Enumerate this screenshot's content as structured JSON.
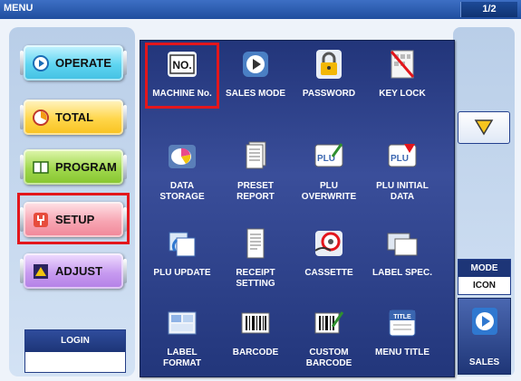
{
  "window": {
    "title": "MENU",
    "page_indicator": "1/2"
  },
  "sidebar": {
    "buttons": [
      {
        "label": "OPERATE",
        "icon": "operate-icon"
      },
      {
        "label": "TOTAL",
        "icon": "total-icon"
      },
      {
        "label": "PROGRAM",
        "icon": "program-icon"
      },
      {
        "label": "SETUP",
        "icon": "setup-icon"
      },
      {
        "label": "ADJUST",
        "icon": "adjust-icon"
      }
    ],
    "login_label": "LOGIN"
  },
  "menu_items": [
    {
      "label": "MACHINE No.",
      "icon": "machine-number-icon"
    },
    {
      "label": "SALES MODE",
      "icon": "sales-mode-icon"
    },
    {
      "label": "PASSWORD",
      "icon": "padlock-icon"
    },
    {
      "label": "KEY LOCK",
      "icon": "key-lock-icon"
    },
    {
      "label": "DATA\nSTORAGE",
      "icon": "data-storage-icon"
    },
    {
      "label": "PRESET\nREPORT",
      "icon": "preset-report-icon"
    },
    {
      "label": "PLU\nOVERWRITE",
      "icon": "plu-overwrite-icon"
    },
    {
      "label": "PLU INITIAL\nDATA",
      "icon": "plu-initial-data-icon"
    },
    {
      "label": "PLU UPDATE",
      "icon": "plu-update-icon"
    },
    {
      "label": "RECEIPT\nSETTING",
      "icon": "receipt-setting-icon"
    },
    {
      "label": "CASSETTE",
      "icon": "cassette-icon"
    },
    {
      "label": "LABEL SPEC.",
      "icon": "label-spec-icon"
    },
    {
      "label": "LABEL\nFORMAT",
      "icon": "label-format-icon"
    },
    {
      "label": "BARCODE",
      "icon": "barcode-icon"
    },
    {
      "label": "CUSTOM\nBARCODE",
      "icon": "custom-barcode-icon"
    },
    {
      "label": "MENU TITLE",
      "icon": "menu-title-icon"
    }
  ],
  "right_panel": {
    "scroll_icon": "triangle-down-icon",
    "mode_label": "MODE",
    "mode_value": "ICON",
    "sales_label": "SALES",
    "sales_icon": "play-arrow-icon"
  },
  "colors": {
    "highlight": "#e3161c",
    "panel": "#2c4188"
  }
}
